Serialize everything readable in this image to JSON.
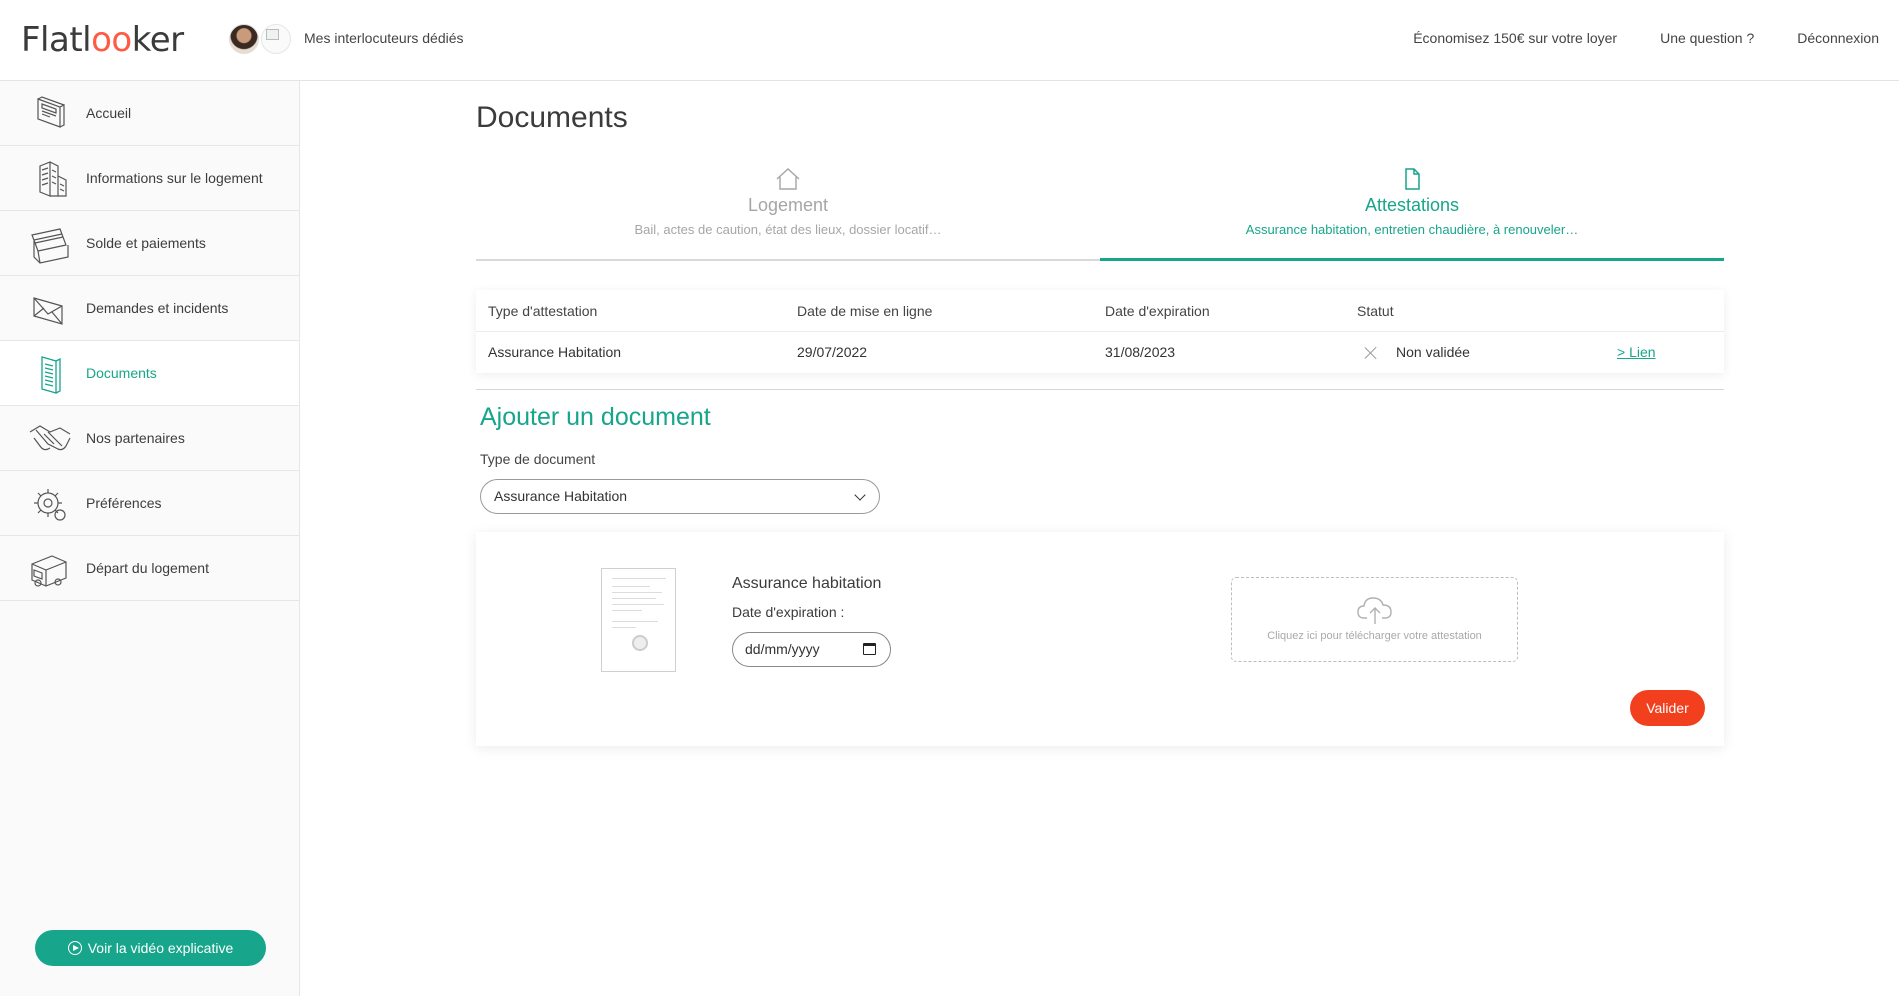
{
  "header": {
    "logo_start": "Flatl",
    "logo_oo": "oo",
    "logo_end": "ker",
    "interlocutors": "Mes interlocuteurs dédiés",
    "links": {
      "save": "Économisez 150€ sur votre loyer",
      "question": "Une question ?",
      "logout": "Déconnexion"
    }
  },
  "sidebar": {
    "items": [
      {
        "label": "Accueil",
        "icon": "home-card-icon"
      },
      {
        "label": "Informations sur le logement",
        "icon": "building-icon"
      },
      {
        "label": "Solde et paiements",
        "icon": "credit-cards-icon"
      },
      {
        "label": "Demandes et incidents",
        "icon": "envelope-icon"
      },
      {
        "label": "Documents",
        "icon": "document-icon",
        "active": true
      },
      {
        "label": "Nos partenaires",
        "icon": "handshake-icon"
      },
      {
        "label": "Préférences",
        "icon": "gear-icon"
      },
      {
        "label": "Départ du logement",
        "icon": "truck-icon"
      }
    ],
    "video_button": "Voir la vidéo explicative"
  },
  "main": {
    "title": "Documents",
    "tabs": [
      {
        "title": "Logement",
        "subtitle": "Bail, actes de caution, état des lieux, dossier locatif…",
        "icon": "house-icon",
        "active": false
      },
      {
        "title": "Attestations",
        "subtitle": "Assurance habitation, entretien chaudière, à renouveler…",
        "icon": "file-icon",
        "active": true
      }
    ],
    "table": {
      "headers": [
        "Type d'attestation",
        "Date de mise en ligne",
        "Date d'expiration",
        "Statut"
      ],
      "rows": [
        {
          "type": "Assurance Habitation",
          "online_date": "29/07/2022",
          "expiry_date": "31/08/2023",
          "status": "Non validée",
          "link": "> Lien"
        }
      ]
    },
    "add_document": {
      "title": "Ajouter un document",
      "type_label": "Type de document",
      "type_value": "Assurance Habitation",
      "card": {
        "title": "Assurance habitation",
        "expiry_label": "Date d'expiration :",
        "date_placeholder": "dd/mm/yyyy",
        "upload_text": "Cliquez ici pour télécharger votre attestation",
        "submit": "Valider"
      }
    }
  },
  "colors": {
    "accent": "#17a58b",
    "logo_accent": "#ff5a43",
    "submit": "#f2401f",
    "muted": "#a6a6a6"
  }
}
